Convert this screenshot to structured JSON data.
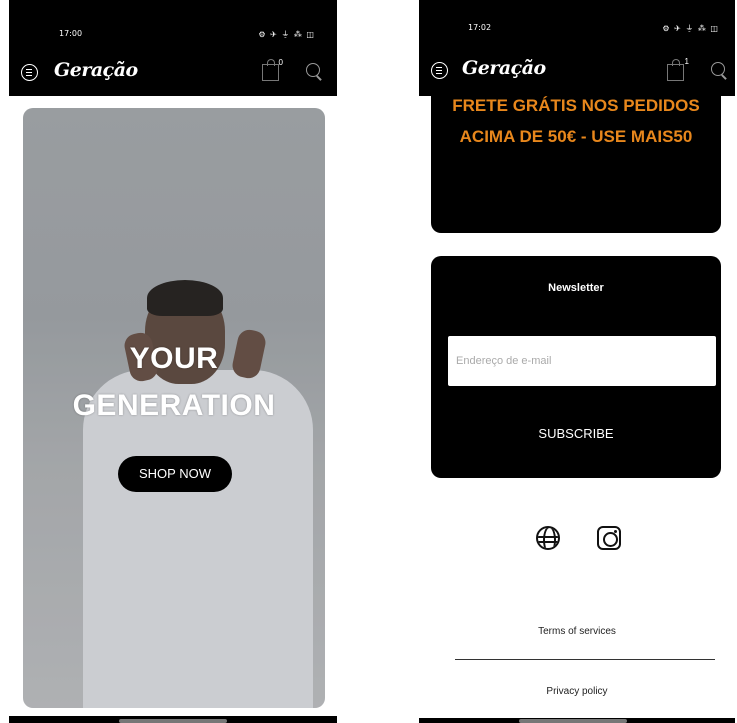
{
  "screen_left": {
    "status": {
      "time": "17:00",
      "icons": "⚙ ✈ ⏚ ⁂ ◫"
    },
    "header": {
      "logo": "Geração",
      "cart_count": "0"
    },
    "hero": {
      "title_line1": "YOUR",
      "title_line2": "GENERATION",
      "button_label": "SHOP NOW"
    }
  },
  "screen_right": {
    "status": {
      "time": "17:02",
      "icons": "⚙ ✈ ⏚ ⁂ ◫"
    },
    "header": {
      "logo": "Geração",
      "cart_count": "1"
    },
    "promo": {
      "line1": "FRETE GRÁTIS NOS PEDIDOS",
      "line2": "ACIMA DE 50€ - USE MAIS50"
    },
    "newsletter": {
      "title": "Newsletter",
      "email_placeholder": "Endereço de e-mail",
      "email_value": "",
      "subscribe_label": "SUBSCRIBE"
    },
    "social": [
      "globe-icon",
      "instagram-icon"
    ],
    "footer": {
      "terms": "Terms of services",
      "privacy": "Privacy policy"
    }
  },
  "colors": {
    "background": "#000000",
    "promo_text": "#e8871c",
    "hero_bg": "#a8abae"
  }
}
